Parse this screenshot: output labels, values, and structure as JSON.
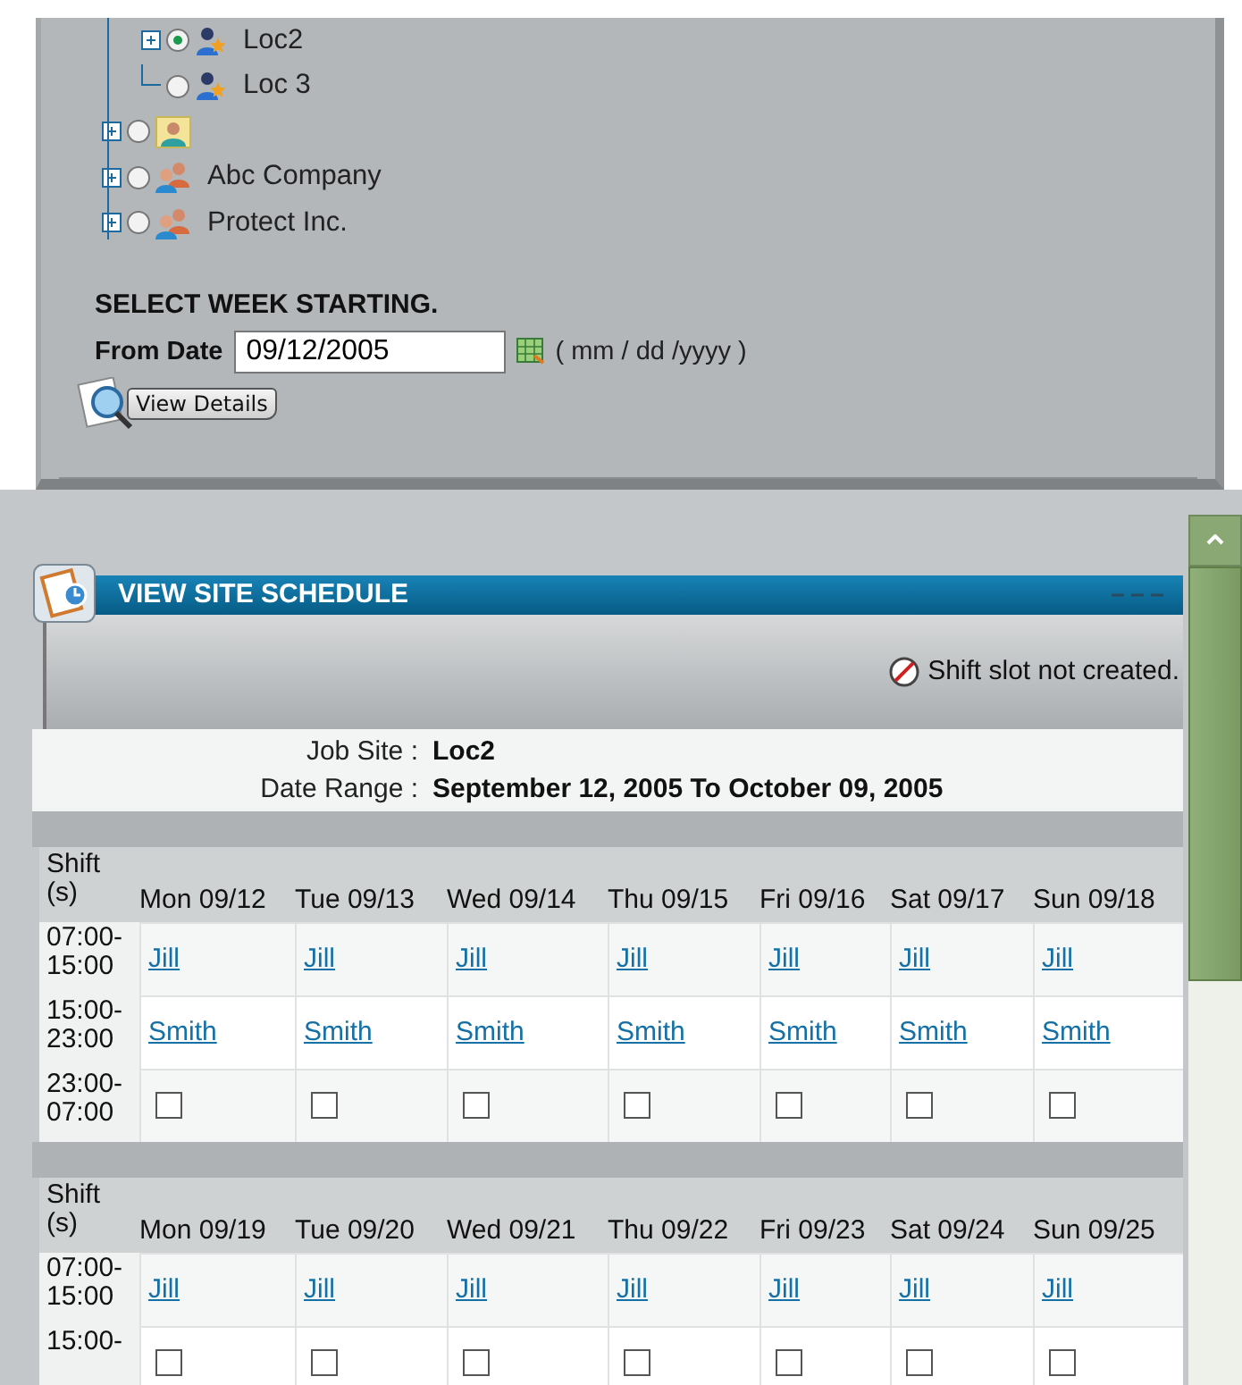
{
  "tree": [
    {
      "children": [
        {
          "label": "Loc2",
          "kind": "location",
          "selected": true,
          "expandable": true
        },
        {
          "label": "Loc 3",
          "kind": "location",
          "selected": false,
          "expandable": false
        }
      ]
    },
    {
      "kind": "site",
      "selected": false,
      "expandable": true
    },
    {
      "label": "Abc Company",
      "kind": "company",
      "selected": false,
      "expandable": true
    },
    {
      "label": "Protect Inc.",
      "kind": "company",
      "selected": false,
      "expandable": true
    }
  ],
  "week_form": {
    "heading": "SELECT WEEK STARTING.",
    "label": "From Date",
    "value": "09/12/2005",
    "format_hint": "( mm / dd /yyyy )",
    "button": "View Details"
  },
  "schedule": {
    "title": "VIEW SITE SCHEDULE",
    "notice": "Shift slot not created.",
    "info": [
      {
        "label": "Job Site :",
        "value": "Loc2"
      },
      {
        "label": "Date Range :",
        "value": "September 12, 2005 To October 09, 2005"
      }
    ],
    "weeks": [
      {
        "shift_header": "Shift (s)",
        "days": [
          "Mon 09/12",
          "Tue 09/13",
          "Wed 09/14",
          "Thu 09/15",
          "Fri 09/16",
          "Sat 09/17",
          "Sun 09/18"
        ],
        "rows": [
          {
            "shift": "07:00- 15:00",
            "cells": [
              {
                "kind": "link",
                "text": "Jill"
              },
              {
                "kind": "link",
                "text": "Jill"
              },
              {
                "kind": "link",
                "text": "Jill"
              },
              {
                "kind": "link",
                "text": "Jill"
              },
              {
                "kind": "link",
                "text": "Jill"
              },
              {
                "kind": "link",
                "text": "Jill"
              },
              {
                "kind": "link",
                "text": "Jill"
              }
            ]
          },
          {
            "shift": "15:00- 23:00",
            "cells": [
              {
                "kind": "link",
                "text": "Smith"
              },
              {
                "kind": "link",
                "text": "Smith"
              },
              {
                "kind": "link",
                "text": "Smith"
              },
              {
                "kind": "link",
                "text": "Smith"
              },
              {
                "kind": "link",
                "text": "Smith"
              },
              {
                "kind": "link",
                "text": "Smith"
              },
              {
                "kind": "link",
                "text": "Smith"
              }
            ]
          },
          {
            "shift": "23:00- 07:00",
            "cells": [
              {
                "kind": "checkbox",
                "checked": false
              },
              {
                "kind": "checkbox",
                "checked": false
              },
              {
                "kind": "checkbox",
                "checked": false
              },
              {
                "kind": "checkbox",
                "checked": false
              },
              {
                "kind": "checkbox",
                "checked": false
              },
              {
                "kind": "checkbox",
                "checked": false
              },
              {
                "kind": "checkbox",
                "checked": false
              }
            ]
          }
        ]
      },
      {
        "shift_header": "Shift (s)",
        "days": [
          "Mon 09/19",
          "Tue 09/20",
          "Wed 09/21",
          "Thu 09/22",
          "Fri 09/23",
          "Sat 09/24",
          "Sun 09/25"
        ],
        "rows": [
          {
            "shift": "07:00- 15:00",
            "cells": [
              {
                "kind": "link",
                "text": "Jill"
              },
              {
                "kind": "link",
                "text": "Jill"
              },
              {
                "kind": "link",
                "text": "Jill"
              },
              {
                "kind": "link",
                "text": "Jill"
              },
              {
                "kind": "link",
                "text": "Jill"
              },
              {
                "kind": "link",
                "text": "Jill"
              },
              {
                "kind": "link",
                "text": "Jill"
              }
            ]
          },
          {
            "shift": "15:00-",
            "cells": [
              {
                "kind": "checkbox",
                "checked": false
              },
              {
                "kind": "checkbox",
                "checked": false
              },
              {
                "kind": "checkbox",
                "checked": false
              },
              {
                "kind": "checkbox",
                "checked": false
              },
              {
                "kind": "checkbox",
                "checked": false
              },
              {
                "kind": "checkbox",
                "checked": false
              },
              {
                "kind": "checkbox",
                "checked": false
              }
            ]
          }
        ]
      }
    ]
  }
}
